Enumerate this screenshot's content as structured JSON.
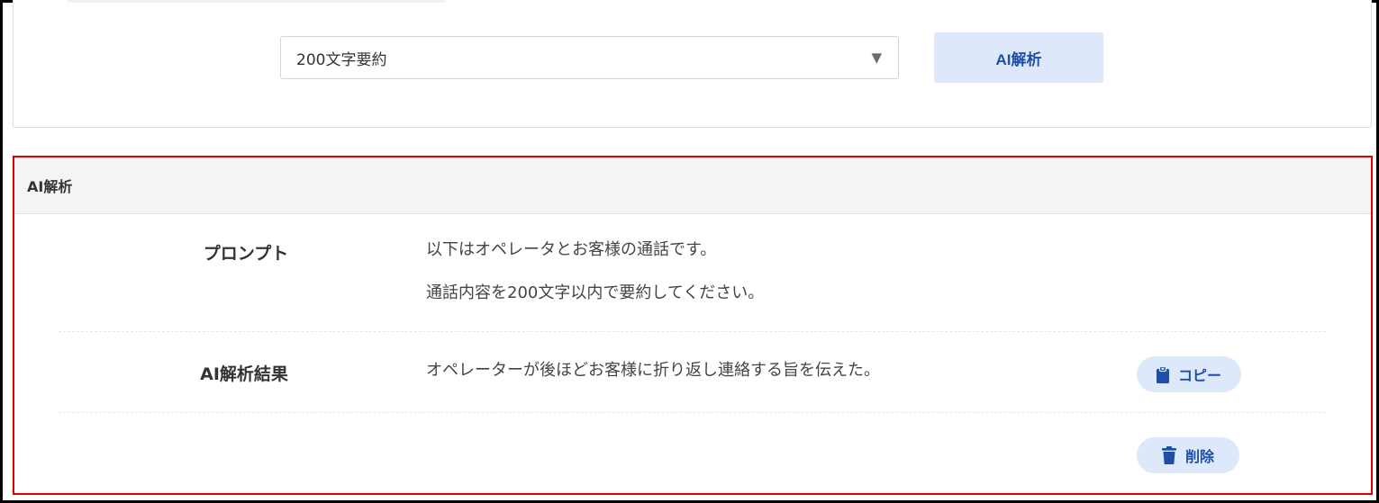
{
  "top": {
    "select_value": "200文字要約",
    "select_caret": "▼",
    "analyze_label": "AI解析"
  },
  "panel": {
    "title": "AI解析",
    "prompt": {
      "label": "プロンプト",
      "lines": [
        "以下はオペレータとお客様の通話です。",
        "通話内容を200文字以内で要約してください。"
      ]
    },
    "result": {
      "label": "AI解析結果",
      "text": "オペレーターが後ほどお客様に折り返し連絡する旨を伝えた。"
    },
    "copy_label": "コピー",
    "delete_label": "削除"
  },
  "icons": {
    "clipboard": "clipboard-icon",
    "trash": "trash-icon"
  },
  "colors": {
    "accent": "#1d4fa8",
    "button_bg": "#dde8fb",
    "highlight_border": "#e00000",
    "header_bg": "#f4f4f4"
  }
}
